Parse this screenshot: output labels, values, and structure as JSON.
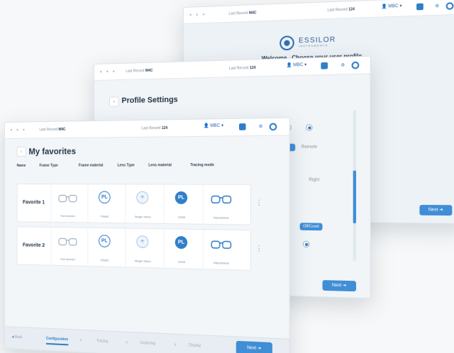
{
  "screen_back": {
    "login_tag": "Last Record",
    "login_id": "M4C",
    "station_tag": "Last Record",
    "station_id": "124",
    "user": "MBC",
    "logo_name": "ESSILOR",
    "logo_sub": "INSTRUMENTS",
    "welcome": "Welcome . Choose your user profile.",
    "next_label": "Next"
  },
  "screen_middle": {
    "login_tag": "Last Record",
    "login_id": "M4C",
    "station_tag": "Last Record",
    "station_id": "124",
    "user": "MBC",
    "title": "Profile Settings",
    "option_1": "Remote",
    "option_2": "Right",
    "toggle_label": "Off/Count",
    "next_label": "Next"
  },
  "screen_front": {
    "login_tag": "Last Record",
    "login_id": "M4C",
    "station_tag": "Last Record",
    "station_id": "124",
    "user": "MBC",
    "title": "My favorites",
    "columns": [
      "Name",
      "Frame Type",
      "Frame material",
      "Lens Type",
      "Lens material",
      "Tracing mode"
    ],
    "favorites": [
      {
        "name": "Favorite 1",
        "frame_type": "Full-rimmed",
        "frame_material": "Plastic",
        "frame_material_badge": "PL",
        "lens_type": "Single Vision",
        "lens_material": "CR39",
        "lens_material_badge": "PL",
        "tracing_mode": "Mechanical"
      },
      {
        "name": "Favorite 2",
        "frame_type": "Full-rimmed",
        "frame_material": "Plastic",
        "frame_material_badge": "PL",
        "lens_type": "Single Vision",
        "lens_material": "CR39",
        "lens_material_badge": "PL",
        "tracing_mode": "Mechanical"
      }
    ],
    "footer": {
      "back_label": "Back",
      "steps": [
        "Configuration",
        "Tracing",
        "Centering",
        "Display"
      ],
      "next_label": "Next"
    }
  },
  "colors": {
    "accent": "#2f7ec9",
    "accent_light": "#3f8ed6",
    "surface": "#f3f6f9",
    "text": "#233447"
  }
}
